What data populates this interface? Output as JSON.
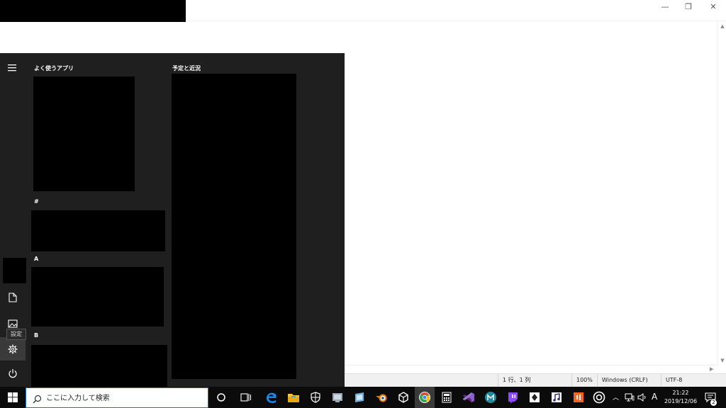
{
  "notepad": {
    "window_controls": {
      "minimize": "—",
      "maximize": "❐",
      "close": "✕"
    },
    "status_bar": {
      "position": "1 行、1 列",
      "zoom": "100%",
      "line_ending": "Windows (CRLF)",
      "encoding": "UTF-8"
    }
  },
  "start_menu": {
    "rail": {
      "settings_tooltip": "設定"
    },
    "sections": {
      "frequent": "よく使うアプリ",
      "schedule": "予定と近況",
      "group_hash": "#",
      "group_a": "A",
      "group_b": "B"
    }
  },
  "taskbar": {
    "search": {
      "placeholder": "ここに入力して検索"
    },
    "tray": {
      "ime": "A",
      "time": "21:22",
      "date": "2019/12/06",
      "notification_count": "2"
    },
    "pinned_icons": [
      "cortana-icon",
      "task-view-icon",
      "edge-icon",
      "file-explorer-icon",
      "security-icon",
      "app-icon",
      "app-icon",
      "blender-icon",
      "unity-icon",
      "chrome-icon",
      "calculator-icon",
      "visual-studio-icon",
      "app-icon",
      "twitch-icon",
      "app-icon",
      "app-icon",
      "app-icon",
      "app-icon"
    ]
  },
  "colors": {
    "start_bg": "#1f1f1f",
    "taskbar_bg": "#0b0b0b",
    "accent": "#1e6fd0"
  }
}
